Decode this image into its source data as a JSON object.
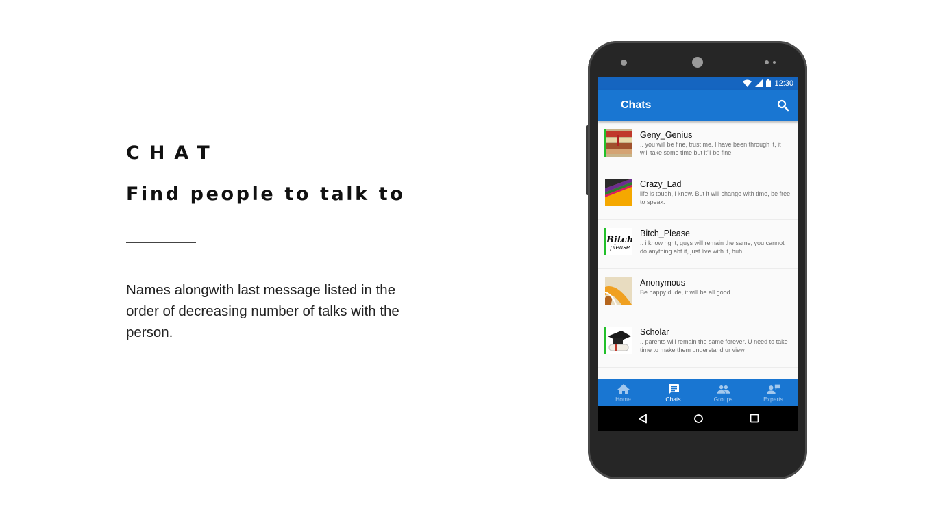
{
  "slide": {
    "title": "CHAT",
    "subtitle": "Find people to talk to",
    "description": "Names alongwith last message listed in the order of decreasing number of talks with the person."
  },
  "status_bar": {
    "time": "12:30"
  },
  "app_bar": {
    "title": "Chats",
    "search_icon": "search-icon"
  },
  "chats": [
    {
      "name": "Geny_Genius",
      "message": ".. you will be fine, trust me. I have been through it, it will take some time but it'll be fine",
      "online": true,
      "avatar": "books-image"
    },
    {
      "name": "Crazy_Lad",
      "message": "life is tough, i know. But it will change with time, be free to speak.",
      "online": false,
      "avatar": "color-paper-image"
    },
    {
      "name": "Bitch_Please",
      "message": ".. i know right, guys will remain the same, you cannot do anything abt it, just live with it, huh",
      "online": true,
      "avatar": "text-logo-image",
      "avatar_text": "Bitch please"
    },
    {
      "name": "Anonymous",
      "message": "Be happy dude, it will be all good",
      "online": false,
      "avatar": "road-image"
    },
    {
      "name": "Scholar",
      "message": ".. parents will remain the same forever. U need to take time to make them understand ur view",
      "online": true,
      "avatar": "graduation-cap-image"
    }
  ],
  "bottom_nav": [
    {
      "label": "Home",
      "icon": "home-icon",
      "active": false
    },
    {
      "label": "Chats",
      "icon": "chat-icon",
      "active": true
    },
    {
      "label": "Groups",
      "icon": "group-icon",
      "active": false
    },
    {
      "label": "Experts",
      "icon": "expert-icon",
      "active": false
    }
  ],
  "colors": {
    "primary": "#1976d2",
    "primary_dark": "#1565c0",
    "online_indicator": "#22c02a",
    "phone_body": "#262626"
  }
}
